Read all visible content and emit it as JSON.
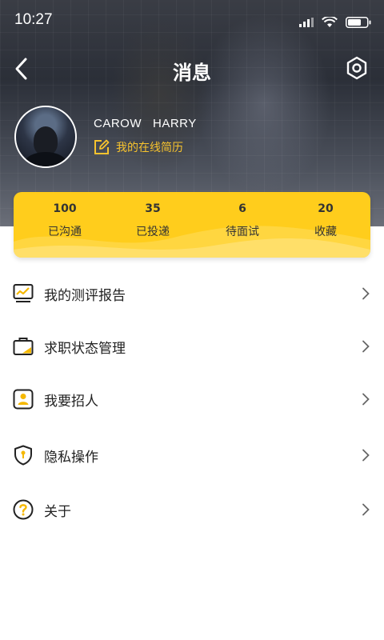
{
  "status": {
    "time": "10:27"
  },
  "header": {
    "title": "消息"
  },
  "profile": {
    "name": "CAROW   HARRY",
    "resume_link": "我的在线简历"
  },
  "stats": [
    {
      "value": "100",
      "label": "已沟通"
    },
    {
      "value": "35",
      "label": "已投递"
    },
    {
      "value": "6",
      "label": "待面试"
    },
    {
      "value": "20",
      "label": "收藏"
    }
  ],
  "menu": [
    {
      "label": "我的测评报告",
      "icon": "report-chart-icon"
    },
    {
      "label": "求职状态管理",
      "icon": "briefcase-icon"
    },
    {
      "label": "我要招人",
      "icon": "recruit-person-icon"
    },
    {
      "label": "隐私操作",
      "icon": "shield-lock-icon"
    },
    {
      "label": "关于",
      "icon": "question-circle-icon"
    }
  ],
  "colors": {
    "accent": "#ffcd1c",
    "link": "#f7c32e",
    "text": "#222222"
  }
}
